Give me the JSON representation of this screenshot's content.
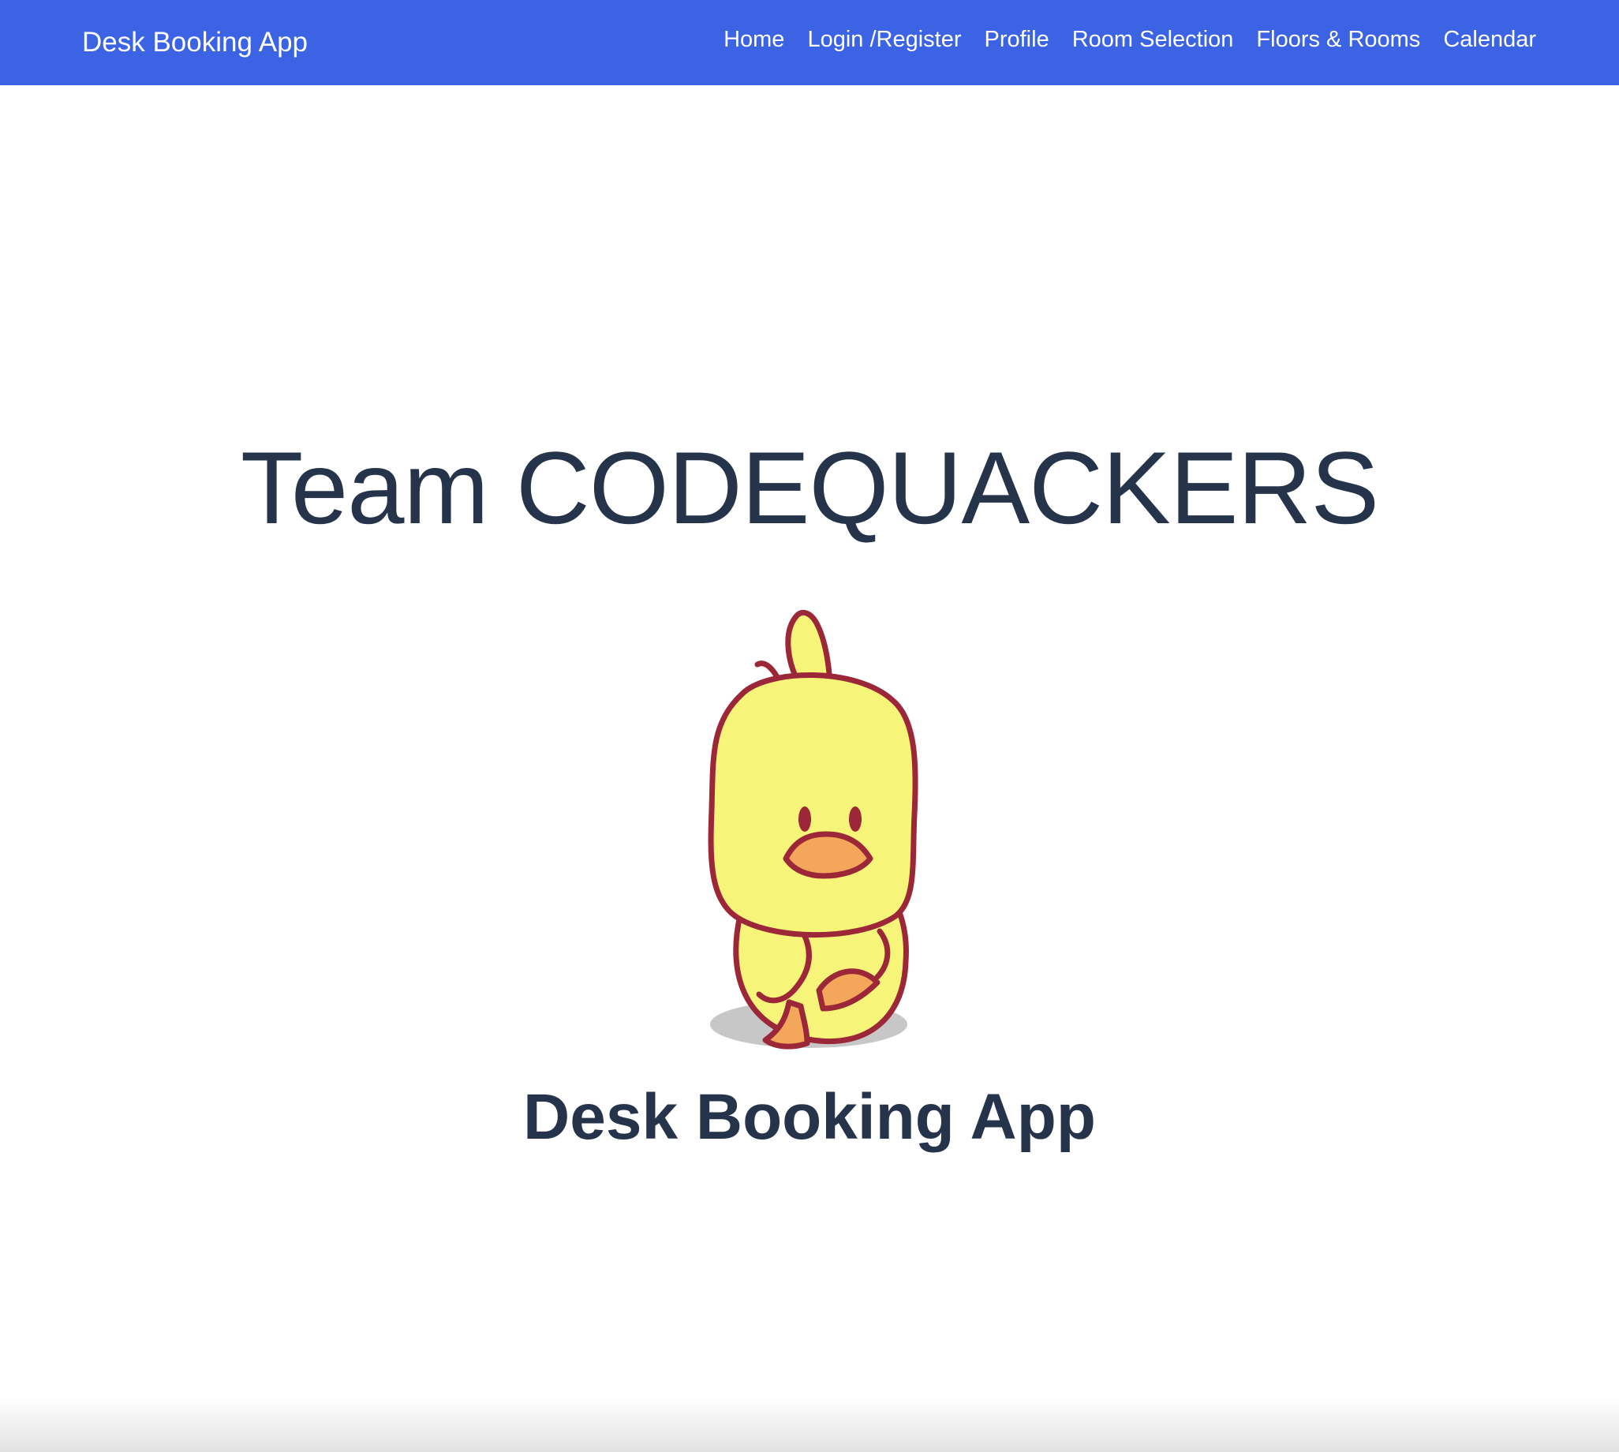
{
  "navbar": {
    "brand": "Desk Booking App",
    "background_color": "#3b63e4",
    "links": [
      {
        "label": "Home"
      },
      {
        "label": "Login /Register"
      },
      {
        "label": "Profile"
      },
      {
        "label": "Room Selection"
      },
      {
        "label": "Floors & Rooms"
      },
      {
        "label": "Calendar"
      }
    ]
  },
  "hero": {
    "title": "Team CODEQUACKERS",
    "app_name": "Desk Booking App",
    "text_color": "#25344a"
  },
  "mascot": {
    "icon": "duck-mascot",
    "body_color": "#f7f47a",
    "outline_color": "#9b2738",
    "beak_color": "#f4a65b"
  }
}
